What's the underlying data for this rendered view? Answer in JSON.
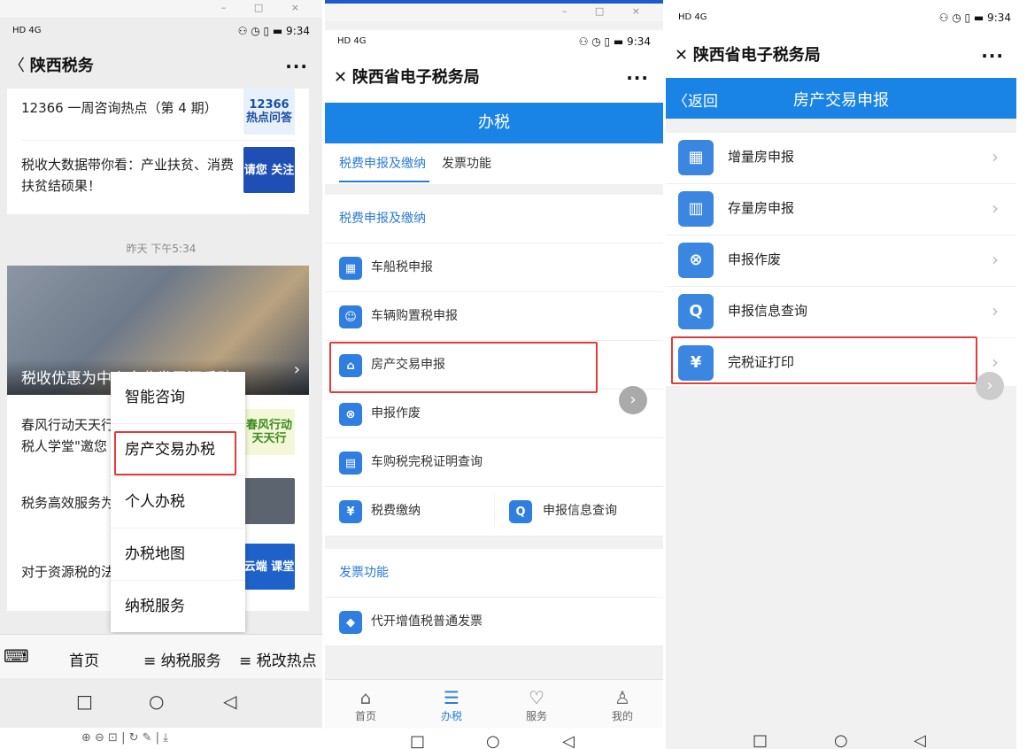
{
  "left": {
    "status_left": "HD 4G",
    "status_right": "⚇ ◷ ▯ ▬ 9:34",
    "nav_title": "陕西税务",
    "nav_more": "···",
    "articles_top": [
      {
        "title": "12366 一周咨询热点（第 4 期）",
        "thumb": "12366 热点问答"
      },
      {
        "title": "税收大数据带你看：产业扶贫、消费扶贫结硕果！",
        "thumb": "请您 关注"
      }
    ],
    "timestamp": "昨天 下午5:34",
    "banner_text": "税收优惠为中小企业发展添后劲",
    "articles": [
      {
        "title": "春风行动天天行 税人学堂\"邀您",
        "thumb": "春风行动 天天行"
      },
      {
        "title": "税务高效服务为",
        "thumb": ""
      },
      {
        "title": "对于资源税的法",
        "thumb": "云端 课堂"
      }
    ],
    "menu": [
      "智能咨询",
      "房产交易办税",
      "个人办税",
      "办税地图",
      "纳税服务"
    ],
    "bottom_bar": {
      "home": "首页",
      "service": "≡ 纳税服务",
      "hot": "≡ 税改热点"
    },
    "sys_nav": {
      "square": "□",
      "circle": "○",
      "back": "◁"
    },
    "toolbar": "⊕ ⊖ ⊡ | ↻ ✎ | ⤓"
  },
  "middle": {
    "status_left": "HD 4G",
    "status_right": "⚇ ◷ ▯ ▬ 9:34",
    "nav_title": "陕西省电子税务局",
    "nav_more": "···",
    "header": "办税",
    "tabs": [
      "税费申报及缴纳",
      "发票功能"
    ],
    "section1": "税费申报及缴纳",
    "items": [
      "车船税申报",
      "车辆购置税申报",
      "房产交易申报",
      "申报作废",
      "车购税完税证明查询"
    ],
    "pair": [
      "税费缴纳",
      "申报信息查询"
    ],
    "section2": "发票功能",
    "invoice_item": "代开增值税普通发票",
    "tabbar": [
      "首页",
      "办税",
      "服务",
      "我的"
    ]
  },
  "right": {
    "status_left": "HD 4G",
    "status_right": "⚇ ◷ ▯ ▬ 9:34",
    "nav_title": "陕西省电子税务局",
    "nav_more": "···",
    "back": "〈返回",
    "header": "房产交易申报",
    "items": [
      "增量房申报",
      "存量房申报",
      "申报作废",
      "申报信息查询",
      "完税证打印"
    ]
  },
  "colors": {
    "accent": "#1a84e6",
    "red": "#e23b3b"
  }
}
